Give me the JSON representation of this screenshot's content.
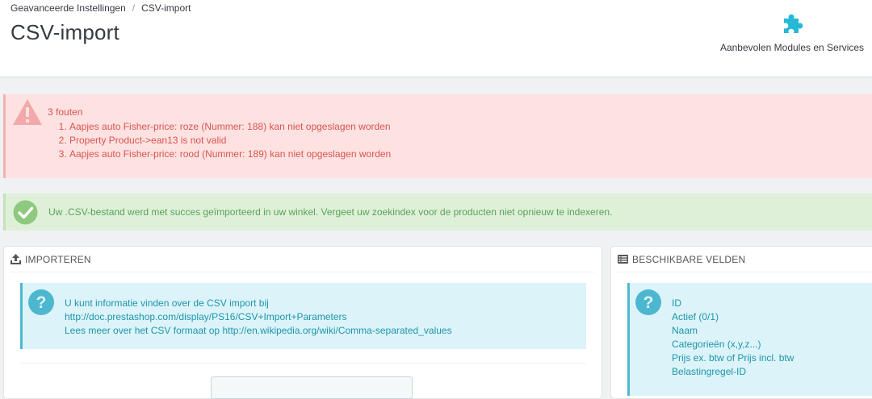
{
  "breadcrumb": {
    "parent": "Geavanceerde Instellingen",
    "separator": "/",
    "current": "CSV-import"
  },
  "page_title": "CSV-import",
  "toolbar": {
    "recommended_label": "Aanbevolen Modules en Services",
    "icon": "puzzle-icon"
  },
  "errors": {
    "count_text": "3 fouten",
    "items": [
      "Aapjes auto Fisher-price: roze (Nummer: 188) kan niet opgeslagen worden",
      "Property Product->ean13 is not valid",
      "Aapjes auto Fisher-price: rood (Nummer: 189) kan niet opgeslagen worden"
    ]
  },
  "success": {
    "message": "Uw .CSV-bestand werd met succes geïmporteerd in uw winkel. Vergeet uw zoekindex voor de producten niet opnieuw te indexeren."
  },
  "import_panel": {
    "heading": "IMPORTEREN",
    "info_line1": "U kunt informatie vinden over de CSV import bij",
    "doc_link": "http://doc.prestashop.com/display/PS16/CSV+Import+Parameters",
    "info_line3_prefix": "Lees meer over het CSV formaat op",
    "wiki_link": "http://en.wikipedia.org/wiki/Comma-separated_values"
  },
  "fields_panel": {
    "heading": "BESCHIKBARE VELDEN",
    "fields": [
      "ID",
      "Actief (0/1)",
      "Naam",
      "Categorieën (x,y,z...)",
      "Prijs ex. btw of Prijs incl. btw",
      "Belastingregel-ID"
    ]
  },
  "colors": {
    "error_bg": "#fee2e2",
    "error_text": "#d9534f",
    "success_bg": "#dff0d8",
    "success_text": "#58a35a",
    "info_bg": "#dcf4f9",
    "info_text": "#1e94ab",
    "accent": "#25b9d7"
  }
}
